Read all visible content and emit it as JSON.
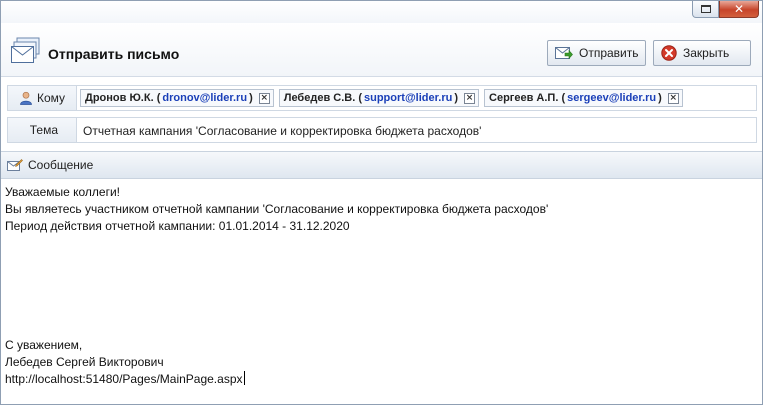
{
  "header": {
    "title": "Отправить письмо",
    "send_label": "Отправить",
    "close_label": "Закрыть"
  },
  "to": {
    "label": "Кому",
    "recipients": [
      {
        "name": "Дронов Ю.К.",
        "email": "dronov@lider.ru"
      },
      {
        "name": "Лебедев С.В.",
        "email": "support@lider.ru"
      },
      {
        "name": "Сергеев А.П.",
        "email": "sergeev@lider.ru"
      }
    ]
  },
  "subject": {
    "label": "Тема",
    "value": "Отчетная кампания 'Согласование и корректировка бюджета расходов'"
  },
  "message": {
    "label": "Сообщение",
    "lines": [
      "Уважаемые коллеги!",
      "Вы являетесь участником отчетной кампании 'Согласование и корректировка бюджета расходов'",
      "Период действия отчетной кампании: 01.01.2014 - 31.12.2020",
      "",
      "",
      "",
      "",
      "",
      "",
      "С уважением,",
      "Лебедев Сергей Викторович",
      "http://localhost:51480/Pages/MainPage.aspx"
    ]
  },
  "colors": {
    "email_link": "#1a3fb8",
    "close_red": "#d33a2a",
    "send_green": "#3b9b2c"
  },
  "icons": {
    "title": "envelope-stack-icon",
    "send": "send-mail-icon",
    "close": "close-circle-icon",
    "to": "user-icon",
    "message": "compose-icon"
  }
}
